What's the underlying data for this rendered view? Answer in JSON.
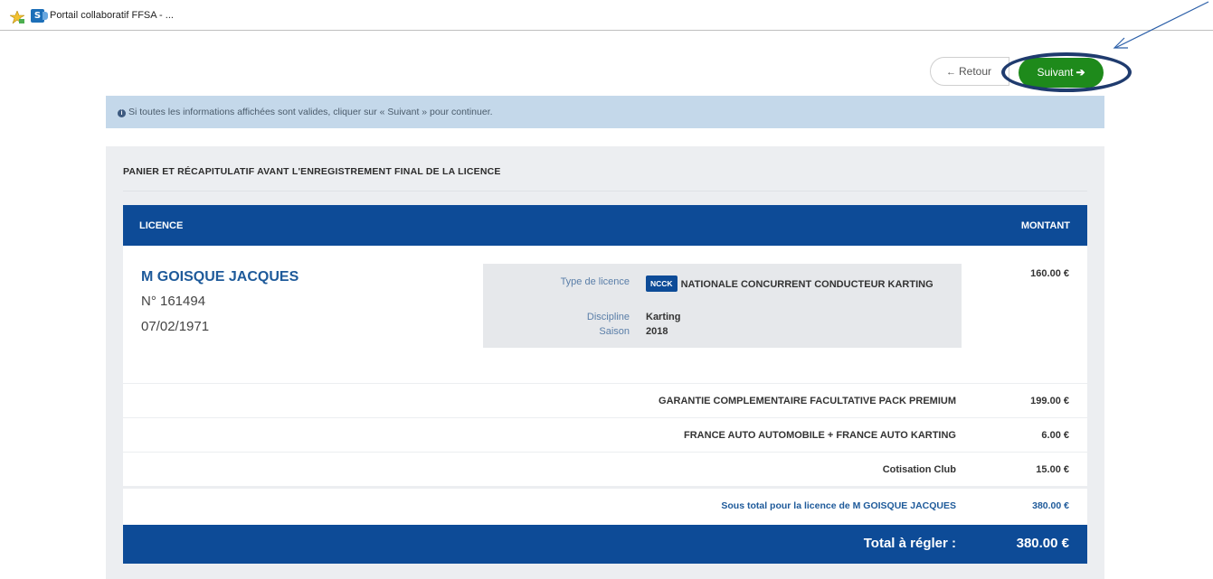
{
  "browser": {
    "tab_title": "Portail collaboratif FFSA - ...",
    "site_icon_text": "S"
  },
  "toolbar": {
    "retour_label": "Retour",
    "suivant_label": "Suivant"
  },
  "info_alert": {
    "text": "Si toutes les informations affichées sont valides, cliquer sur « Suivant » pour continuer."
  },
  "panel": {
    "title": "PANIER ET RÉCAPITULATIF AVANT L'ENREGISTREMENT FINAL DE LA LICENCE"
  },
  "table": {
    "col_licence": "LICENCE",
    "col_montant": "MONTANT"
  },
  "person": {
    "name": "M GOISQUE JACQUES",
    "number": "N° 161494",
    "dob": "07/02/1971"
  },
  "licence": {
    "type_label": "Type de licence",
    "type_badge": "NCCK",
    "type_value": "NATIONALE CONCURRENT CONDUCTEUR KARTING",
    "discipline_label": "Discipline",
    "discipline_value": "Karting",
    "saison_label": "Saison",
    "saison_value": "2018",
    "amount": "160.00 €"
  },
  "lines": [
    {
      "desc": "GARANTIE COMPLEMENTAIRE FACULTATIVE PACK PREMIUM",
      "amount": "199.00 €"
    },
    {
      "desc": "FRANCE AUTO AUTOMOBILE + FRANCE AUTO KARTING",
      "amount": "6.00 €"
    },
    {
      "desc": "Cotisation Club",
      "amount": "15.00 €"
    }
  ],
  "subtotal": {
    "desc": "Sous total pour la licence de M GOISQUE JACQUES",
    "amount": "380.00 €"
  },
  "total": {
    "label": "Total à régler :",
    "amount": "380.00 €"
  },
  "colors": {
    "primary_blue": "#0d4b97",
    "success_green": "#1e8a1b",
    "alert_bg": "#c4d8ea",
    "annotation_ring": "#1f3b6e"
  }
}
